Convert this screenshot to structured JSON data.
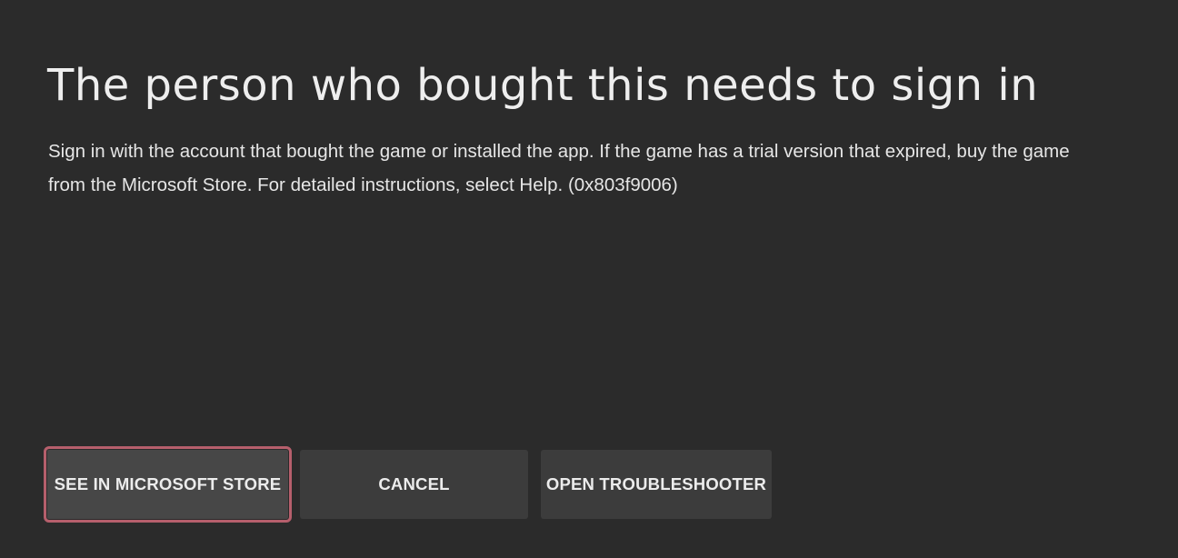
{
  "dialog": {
    "title": "The person who bought this needs to sign in",
    "message_line1": "Sign in with the account that bought the game or installed the app. If the game has a trial version that expired, buy the game",
    "message_line2": "from the Microsoft Store. For detailed instructions, select Help. (0x803f9006)"
  },
  "buttons": {
    "store_label": "SEE IN MICROSOFT STORE",
    "cancel_label": "CANCEL",
    "troubleshoot_label": "OPEN TROUBLESHOOTER"
  },
  "colors": {
    "background": "#2b2b2b",
    "button": "#3c3c3c",
    "focus_ring": "#b65f6c"
  }
}
